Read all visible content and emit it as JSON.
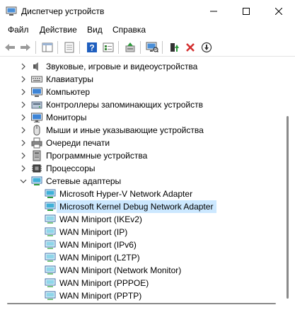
{
  "window": {
    "title": "Диспетчер устройств",
    "icon": "device-manager-icon"
  },
  "menu": {
    "file": "Файл",
    "action": "Действие",
    "view": "Вид",
    "help": "Справка"
  },
  "toolbar": {
    "buttons": [
      "back-arrow-icon",
      "forward-arrow-icon",
      "show-hide-icon",
      "properties-icon",
      "help-icon",
      "view-icon",
      "update-driver-icon",
      "scan-hardware-icon",
      "enable-device-icon",
      "uninstall-icon",
      "disable-device-icon"
    ]
  },
  "tree": {
    "categories": [
      {
        "label": "Звуковые, игровые и видеоустройства",
        "icon": "speaker-icon",
        "expanded": false
      },
      {
        "label": "Клавиатуры",
        "icon": "keyboard-icon",
        "expanded": false
      },
      {
        "label": "Компьютер",
        "icon": "computer-icon",
        "expanded": false
      },
      {
        "label": "Контроллеры запоминающих устройств",
        "icon": "storage-controller-icon",
        "expanded": false
      },
      {
        "label": "Мониторы",
        "icon": "monitor-icon",
        "expanded": false
      },
      {
        "label": "Мыши и иные указывающие устройства",
        "icon": "mouse-icon",
        "expanded": false
      },
      {
        "label": "Очереди печати",
        "icon": "printer-icon",
        "expanded": false
      },
      {
        "label": "Программные устройства",
        "icon": "software-device-icon",
        "expanded": false
      },
      {
        "label": "Процессоры",
        "icon": "processor-icon",
        "expanded": false
      },
      {
        "label": "Сетевые адаптеры",
        "icon": "network-adapter-icon",
        "expanded": true
      }
    ],
    "adapters": [
      {
        "label": "Microsoft Hyper-V Network Adapter",
        "selected": false
      },
      {
        "label": "Microsoft Kernel Debug Network Adapter",
        "selected": true
      },
      {
        "label": "WAN Miniport (IKEv2)",
        "selected": false
      },
      {
        "label": "WAN Miniport (IP)",
        "selected": false
      },
      {
        "label": "WAN Miniport (IPv6)",
        "selected": false
      },
      {
        "label": "WAN Miniport (L2TP)",
        "selected": false
      },
      {
        "label": "WAN Miniport (Network Monitor)",
        "selected": false
      },
      {
        "label": "WAN Miniport (PPPOE)",
        "selected": false
      },
      {
        "label": "WAN Miniport (PPTP)",
        "selected": false
      }
    ]
  },
  "colors": {
    "selection": "#cce8ff",
    "accent_green": "#2e9a3c",
    "delete_red": "#d32f2f"
  }
}
